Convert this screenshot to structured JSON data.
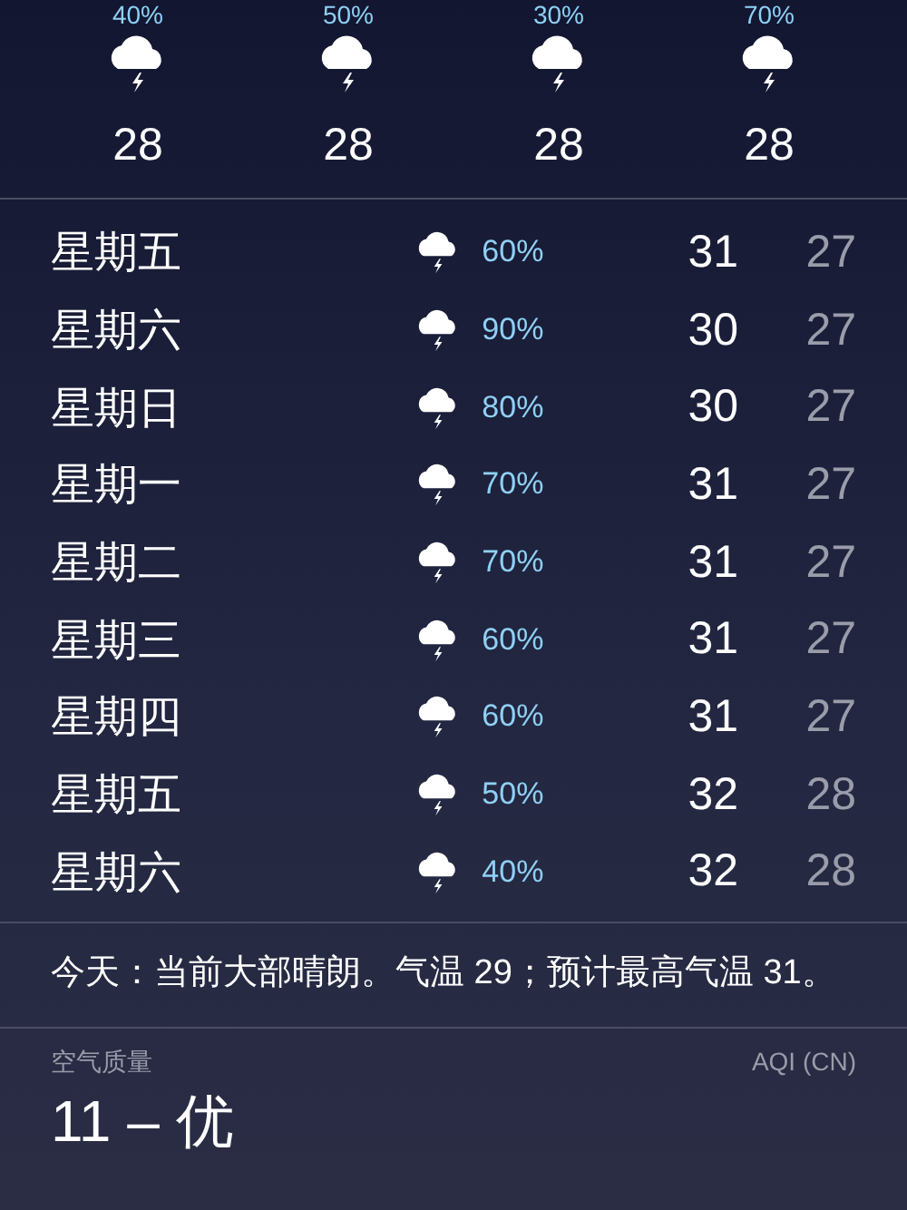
{
  "hourly": [
    {
      "chance": "40%",
      "temp": "28"
    },
    {
      "chance": "50%",
      "temp": "28"
    },
    {
      "chance": "30%",
      "temp": "28"
    },
    {
      "chance": "70%",
      "temp": "28"
    }
  ],
  "daily": [
    {
      "day": "星期五",
      "chance": "60%",
      "high": "31",
      "low": "27"
    },
    {
      "day": "星期六",
      "chance": "90%",
      "high": "30",
      "low": "27"
    },
    {
      "day": "星期日",
      "chance": "80%",
      "high": "30",
      "low": "27"
    },
    {
      "day": "星期一",
      "chance": "70%",
      "high": "31",
      "low": "27"
    },
    {
      "day": "星期二",
      "chance": "70%",
      "high": "31",
      "low": "27"
    },
    {
      "day": "星期三",
      "chance": "60%",
      "high": "31",
      "low": "27"
    },
    {
      "day": "星期四",
      "chance": "60%",
      "high": "31",
      "low": "27"
    },
    {
      "day": "星期五",
      "chance": "50%",
      "high": "32",
      "low": "28"
    },
    {
      "day": "星期六",
      "chance": "40%",
      "high": "32",
      "low": "28"
    }
  ],
  "summary": "今天：当前大部晴朗。气温 29；预计最高气温 31。",
  "air_quality": {
    "label": "空气质量",
    "scale": "AQI (CN)",
    "value": "11 – 优"
  }
}
